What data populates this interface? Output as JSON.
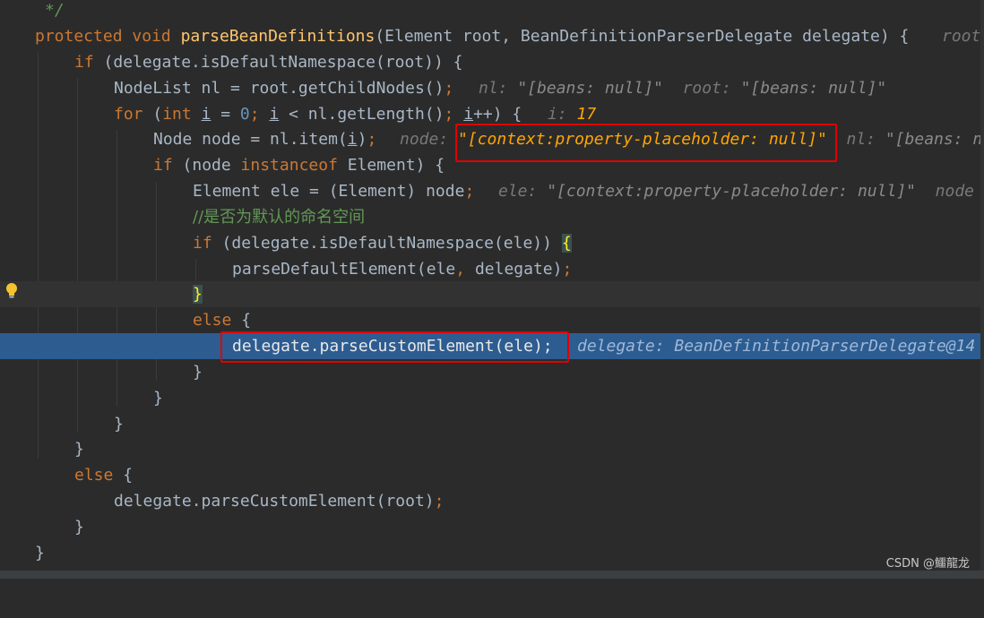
{
  "editor": {
    "lines": [
      {
        "segments": [
          {
            "t": "*/",
            "c": "cmt"
          }
        ]
      },
      {
        "segments": [
          {
            "t": "protected",
            "c": "kw"
          },
          {
            "t": " "
          },
          {
            "t": "void",
            "c": "kw"
          },
          {
            "t": " "
          },
          {
            "t": "parseBeanDefinitions",
            "c": "fn"
          },
          {
            "t": "(Element root, BeanDefinitionParserDelegate delegate) {"
          }
        ],
        "hint": [
          {
            "t": "root"
          }
        ]
      },
      {
        "segments": [
          {
            "t": "if",
            "c": "kw"
          },
          {
            "t": " (delegate.isDefaultNamespace(root)) {"
          }
        ]
      },
      {
        "segments": [
          {
            "t": "NodeList nl = root.getChildNodes()"
          },
          {
            "t": ";",
            "c": "kw"
          }
        ],
        "hint": [
          {
            "t": "nl: "
          },
          {
            "t": "\"[beans: null]\"",
            "v": true
          },
          {
            "t": "  root: "
          },
          {
            "t": "\"[beans: null]\"",
            "v": true
          }
        ]
      },
      {
        "segments": [
          {
            "t": "for",
            "c": "kw"
          },
          {
            "t": " ("
          },
          {
            "t": "int",
            "c": "kw"
          },
          {
            "t": " "
          },
          {
            "t": "i",
            "c": "ul"
          },
          {
            "t": " = "
          },
          {
            "t": "0",
            "c": "num"
          },
          {
            "t": "; ",
            "c": "kw"
          },
          {
            "t": "i",
            "c": "ul"
          },
          {
            "t": " < nl.getLength()"
          },
          {
            "t": "; ",
            "c": "kw"
          },
          {
            "t": "i",
            "c": "ul"
          },
          {
            "t": "++) {"
          }
        ],
        "hint": [
          {
            "t": "i: "
          },
          {
            "t": "17",
            "c": "orange"
          }
        ]
      },
      {
        "segments": [
          {
            "t": "Node node = nl.item("
          },
          {
            "t": "i",
            "c": "ul"
          },
          {
            "t": ")"
          },
          {
            "t": ";",
            "c": "kw"
          }
        ],
        "hint": [
          {
            "t": "node: "
          },
          {
            "t": "\"[context:property-placeholder: null]\"",
            "c": "orange"
          },
          {
            "t": "  nl: "
          },
          {
            "t": "\"[beans: n",
            "v": true
          }
        ]
      },
      {
        "segments": [
          {
            "t": "if",
            "c": "kw"
          },
          {
            "t": " (node "
          },
          {
            "t": "instanceof",
            "c": "kw"
          },
          {
            "t": " Element) {"
          }
        ]
      },
      {
        "segments": [
          {
            "t": "Element ele = (Element) node"
          },
          {
            "t": ";",
            "c": "kw"
          }
        ],
        "hint": [
          {
            "t": "ele: "
          },
          {
            "t": "\"[context:property-placeholder: null]\"",
            "v": true
          },
          {
            "t": "  node"
          }
        ]
      },
      {
        "segments": [
          {
            "t": "//是否为默认的命名空间",
            "c": "cmtzh"
          }
        ]
      },
      {
        "segments": [
          {
            "t": "if",
            "c": "kw"
          },
          {
            "t": " (delegate.isDefaultNamespace(ele)) "
          },
          {
            "t": "{",
            "c": "brace"
          }
        ]
      },
      {
        "segments": [
          {
            "t": "parseDefaultElement(ele"
          },
          {
            "t": ", ",
            "c": "kw"
          },
          {
            "t": "delegate)"
          },
          {
            "t": ";",
            "c": "kw"
          }
        ]
      },
      {
        "segments": [
          {
            "t": "}",
            "c": "brace"
          }
        ]
      },
      {
        "segments": [
          {
            "t": "else",
            "c": "kw"
          },
          {
            "t": " {"
          }
        ]
      },
      {
        "segments": [
          {
            "t": "delegate.parseCustomElement(ele);"
          }
        ],
        "hint": [
          {
            "t": "delegate: BeanDefinitionParserDelegate@14"
          }
        ]
      },
      {
        "segments": [
          {
            "t": "}"
          }
        ]
      },
      {
        "segments": [
          {
            "t": "}"
          }
        ]
      },
      {
        "segments": [
          {
            "t": "}"
          }
        ]
      },
      {
        "segments": [
          {
            "t": "}"
          }
        ]
      },
      {
        "segments": [
          {
            "t": "else",
            "c": "kw"
          },
          {
            "t": " {"
          }
        ]
      },
      {
        "segments": [
          {
            "t": "delegate.parseCustomElement(root)"
          },
          {
            "t": ";",
            "c": "kw"
          }
        ]
      },
      {
        "segments": [
          {
            "t": "}"
          }
        ]
      },
      {
        "segments": [
          {
            "t": "}"
          }
        ]
      }
    ],
    "icons": [
      "lightbulb-icon"
    ]
  },
  "watermark": {
    "text": "CSDN @鱷龍龙"
  },
  "colors": {
    "background": "#2b2b2b",
    "keyword": "#cc7832",
    "method": "#ffc66d",
    "number": "#6897bb",
    "comment": "#629755",
    "execution_line": "#2d5c91",
    "highlight_box": "#e00000"
  }
}
